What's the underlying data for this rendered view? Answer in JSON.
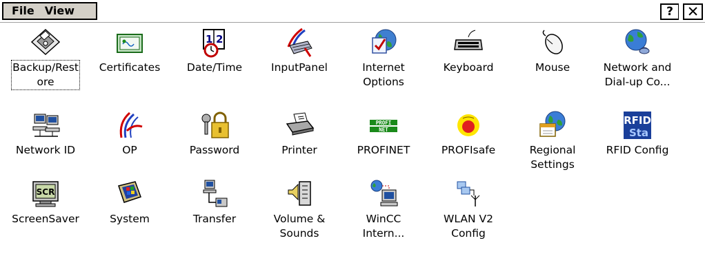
{
  "menu": {
    "file": "File",
    "view": "View"
  },
  "window_buttons": {
    "help": "?",
    "close": "✕"
  },
  "items": [
    {
      "line1": "Backup/Rest",
      "line2": "ore",
      "icon": "floppy-disk-icon",
      "selected": true
    },
    {
      "line1": "Certificates",
      "line2": "",
      "icon": "certificate-icon"
    },
    {
      "line1": "Date/Time",
      "line2": "",
      "icon": "calendar-clock-icon"
    },
    {
      "line1": "InputPanel",
      "line2": "",
      "icon": "input-panel-icon"
    },
    {
      "line1": "Internet",
      "line2": "Options",
      "icon": "globe-check-icon"
    },
    {
      "line1": "Keyboard",
      "line2": "",
      "icon": "keyboard-icon"
    },
    {
      "line1": "Mouse",
      "line2": "",
      "icon": "mouse-icon"
    },
    {
      "line1": "Network and",
      "line2": "Dial-up Co...",
      "icon": "network-globe-icon"
    },
    {
      "line1": "Network ID",
      "line2": "",
      "icon": "network-computers-icon"
    },
    {
      "line1": "OP",
      "line2": "",
      "icon": "op-logo-icon"
    },
    {
      "line1": "Password",
      "line2": "",
      "icon": "keys-padlock-icon"
    },
    {
      "line1": "Printer",
      "line2": "",
      "icon": "printer-icon"
    },
    {
      "line1": "PROFINET",
      "line2": "",
      "icon": "profinet-icon"
    },
    {
      "line1": "PROFIsafe",
      "line2": "",
      "icon": "profisafe-icon"
    },
    {
      "line1": "Regional",
      "line2": "Settings",
      "icon": "globe-calendar-icon"
    },
    {
      "line1": "RFID Config",
      "line2": "",
      "icon": "rfid-icon"
    },
    {
      "line1": "ScreenSaver",
      "line2": "",
      "icon": "screensaver-icon"
    },
    {
      "line1": "System",
      "line2": "",
      "icon": "system-computer-icon"
    },
    {
      "line1": "Transfer",
      "line2": "",
      "icon": "transfer-icon"
    },
    {
      "line1": "Volume &",
      "line2": "Sounds",
      "icon": "speaker-icon"
    },
    {
      "line1": "WinCC",
      "line2": "Intern...",
      "icon": "wincc-globe-icon"
    },
    {
      "line1": "WLAN V2",
      "line2": "Config",
      "icon": "wlan-icon"
    }
  ],
  "icon_text": {
    "rfid_top": "RFID",
    "rfid_bottom": "Sta",
    "scr": "SCR",
    "profi": "PROFI",
    "net": "NET",
    "date1": "1",
    "date2": "2"
  }
}
